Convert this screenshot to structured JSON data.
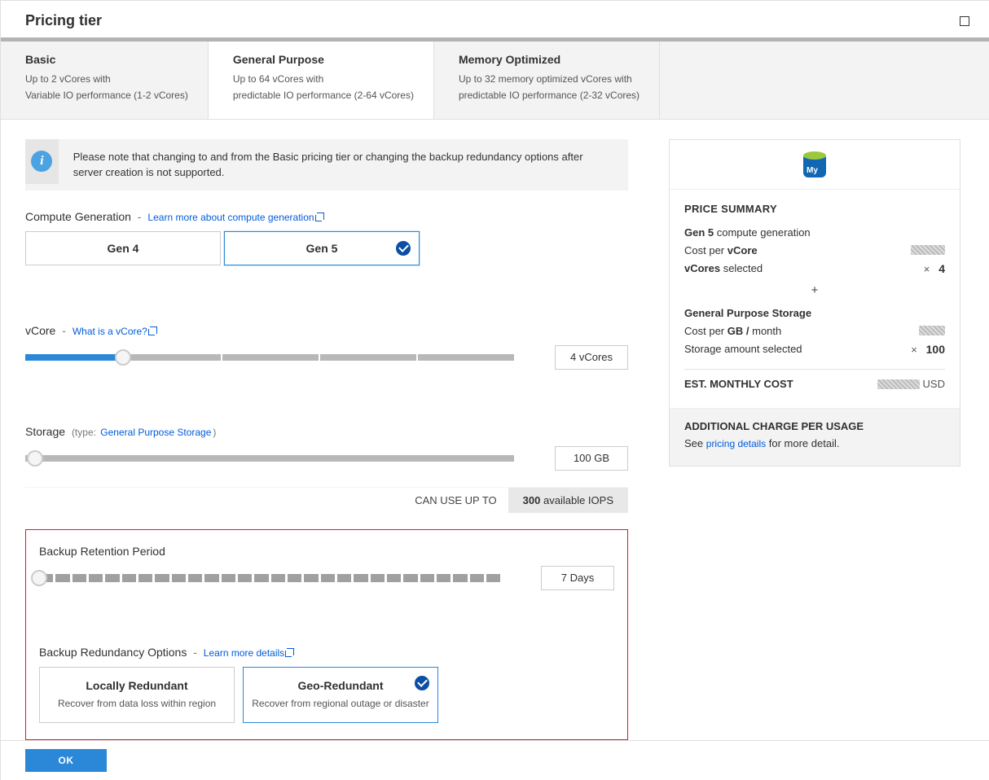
{
  "header": {
    "title": "Pricing tier"
  },
  "tabs": [
    {
      "title": "Basic",
      "line1": "Up to 2 vCores with",
      "line2": "Variable IO performance (1-2 vCores)"
    },
    {
      "title": "General Purpose",
      "line1": "Up to 64 vCores with",
      "line2": "predictable IO performance (2-64 vCores)"
    },
    {
      "title": "Memory Optimized",
      "line1": "Up to 32 memory optimized vCores with",
      "line2": "predictable IO performance (2-32 vCores)"
    }
  ],
  "info_banner": "Please note that changing to and from the Basic pricing tier or changing the backup redundancy options after server creation is not supported.",
  "compute": {
    "label": "Compute Generation",
    "link": "Learn more about compute generation",
    "options": {
      "gen4": "Gen 4",
      "gen5": "Gen 5"
    }
  },
  "vcore": {
    "label": "vCore",
    "link": "What is a vCore?",
    "value_display": "4 vCores"
  },
  "storage": {
    "label": "Storage",
    "type_prefix": "(type:",
    "type_link": "General Purpose Storage",
    "type_suffix": ")",
    "value_display": "100 GB"
  },
  "iops": {
    "prefix": "CAN USE UP TO",
    "value": "300",
    "suffix": "available IOPS"
  },
  "backup": {
    "label": "Backup Retention Period",
    "value_display": "7 Days",
    "redundancy_label": "Backup Redundancy Options",
    "redundancy_link": "Learn more details",
    "opts": {
      "local_title": "Locally Redundant",
      "local_sub": "Recover from data loss within region",
      "geo_title": "Geo-Redundant",
      "geo_sub": "Recover from regional outage or disaster"
    }
  },
  "ok_label": "OK",
  "price": {
    "summary_title": "PRICE SUMMARY",
    "gen_prefix": "Gen 5",
    "gen_suffix": "compute generation",
    "cost_per_vcore_label_a": "Cost per",
    "cost_per_vcore_label_b": "vCore",
    "vcores_selected_a": "vCores",
    "vcores_selected_b": "selected",
    "vcores_value": "4",
    "times": "×",
    "plus": "+",
    "storage_title": "General Purpose Storage",
    "cost_per_gb_a": "Cost per",
    "cost_per_gb_b": "GB /",
    "cost_per_gb_c": "month",
    "storage_amount_label": "Storage amount selected",
    "storage_amount_value": "100",
    "est_label": "EST. MONTHLY COST",
    "currency": "USD",
    "addl_title": "ADDITIONAL CHARGE PER USAGE",
    "addl_prefix": "See",
    "addl_link": "pricing details",
    "addl_suffix": "for more detail."
  }
}
